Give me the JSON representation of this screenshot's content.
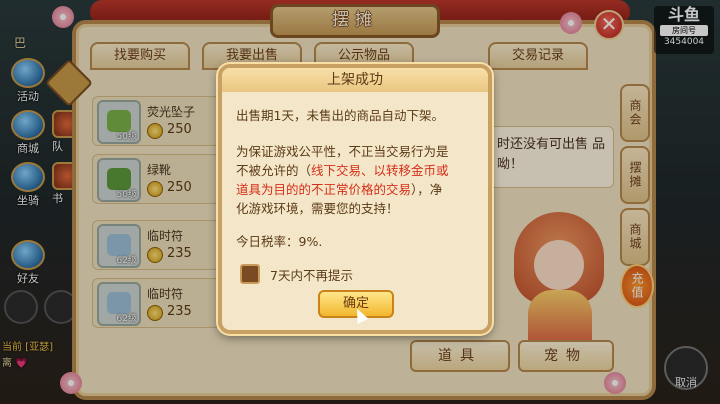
{
  "hud": {
    "left_items": [
      "活动",
      "商城",
      "坐骑",
      "好友"
    ],
    "left_top_text": "巴",
    "right_short": [
      "队",
      "书"
    ],
    "chat_lines": [
      "当前 [亚瑟]",
      "离 💗"
    ]
  },
  "panel": {
    "title": "摆摊",
    "tabs": [
      "找要购买",
      "我要出售",
      "公示物品",
      "交易记录"
    ],
    "items": [
      {
        "name": "荧光坠子",
        "level": "50级",
        "price": "250"
      },
      {
        "name": "绿靴",
        "level": "50级",
        "price": "250"
      },
      {
        "name": "临时符",
        "level": "62级",
        "price": "235"
      },
      {
        "name": "临时符",
        "level": "62级",
        "price": "235"
      }
    ],
    "right_info": "时还没有可出售 \n品呦！",
    "side_tabs": [
      "商会",
      "摆摊",
      "商城",
      "充值"
    ],
    "bottom_buttons": [
      "道具",
      "宠物"
    ],
    "cancel_label": "取消",
    "close_label": "✕"
  },
  "live_badge": {
    "logo": "斗鱼",
    "room_label": "房间号",
    "room_number": "3454004"
  },
  "modal": {
    "title": "上架成功",
    "line1": "出售期1天，未售出的商品自动下架。",
    "para_a": "为保证游戏公平性，不正当交易行为是",
    "para_b": "不被允许的（",
    "para_red1": "线下交易、以转移金币或",
    "para_red2": "道具为目的的不正常价格的交易",
    "para_c": "），净",
    "para_d": "化游戏环境，需要您的支持！",
    "tax": "今日税率：9%.",
    "checkbox_label": "7天内不再提示",
    "ok_label": "确定"
  }
}
